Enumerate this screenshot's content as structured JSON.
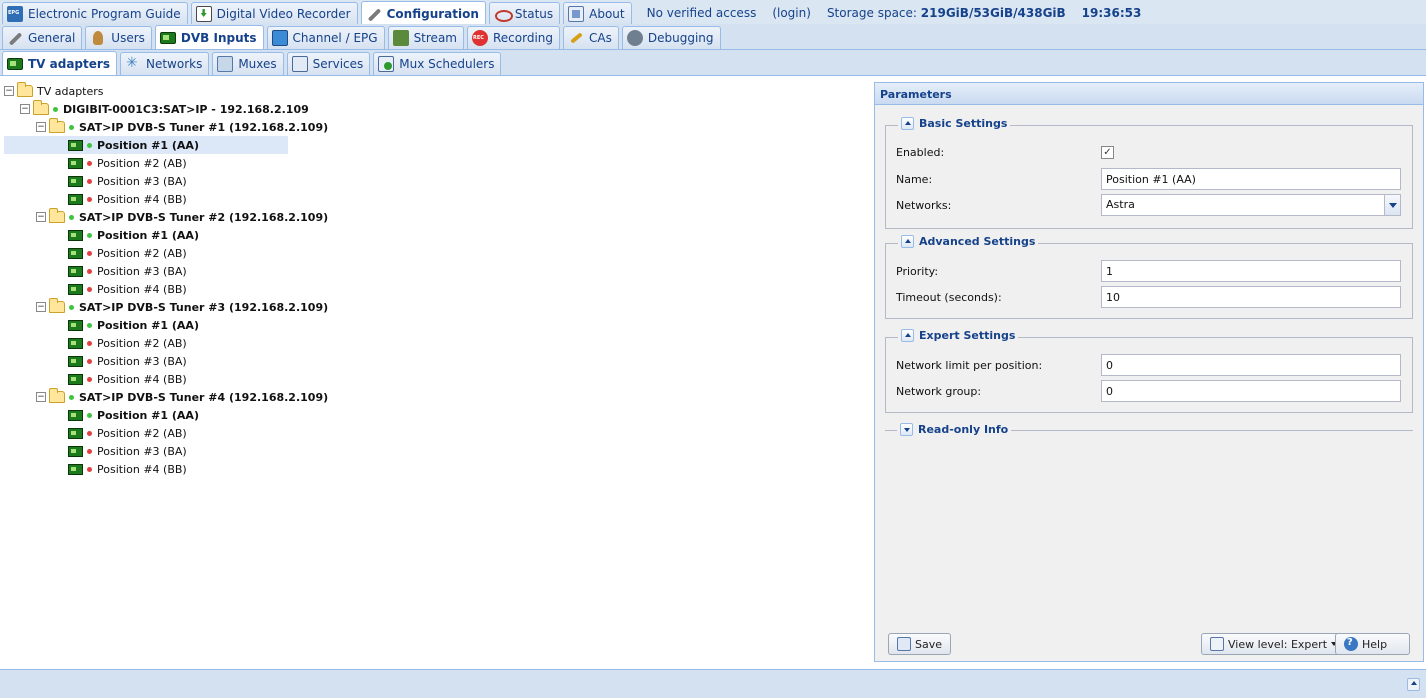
{
  "top_tabs": [
    {
      "label": "Electronic Program Guide",
      "icon": "epg-icon"
    },
    {
      "label": "Digital Video Recorder",
      "icon": "dvr-icon"
    },
    {
      "label": "Configuration",
      "icon": "wrench-icon",
      "active": true
    },
    {
      "label": "Status",
      "icon": "eye-icon"
    },
    {
      "label": "About",
      "icon": "about-icon"
    }
  ],
  "top_info": {
    "access": "No verified access",
    "login": "(login)",
    "storage_label": "Storage space:",
    "storage_value": "219GiB/53GiB/438GiB",
    "time": "19:36:53"
  },
  "config_tabs": [
    {
      "label": "General",
      "icon": "tools-icon"
    },
    {
      "label": "Users",
      "icon": "users-icon"
    },
    {
      "label": "DVB Inputs",
      "icon": "dvb-card-icon",
      "active": true
    },
    {
      "label": "Channel / EPG",
      "icon": "tv-icon"
    },
    {
      "label": "Stream",
      "icon": "stream-icon"
    },
    {
      "label": "Recording",
      "icon": "rec-icon"
    },
    {
      "label": "CAs",
      "icon": "key-icon"
    },
    {
      "label": "Debugging",
      "icon": "debug-icon"
    }
  ],
  "dvb_tabs": [
    {
      "label": "TV adapters",
      "icon": "dvb-card-icon",
      "active": true
    },
    {
      "label": "Networks",
      "icon": "network-icon"
    },
    {
      "label": "Muxes",
      "icon": "mux-icon"
    },
    {
      "label": "Services",
      "icon": "services-icon"
    },
    {
      "label": "Mux Schedulers",
      "icon": "scheduler-icon"
    }
  ],
  "tree": {
    "root": "TV adapters",
    "device": "DIGIBIT-0001C3:SAT>IP - 192.168.2.109",
    "tuners": [
      {
        "label": "SAT>IP DVB-S Tuner #1 (192.168.2.109)",
        "positions": [
          {
            "label": "Position #1 (AA)",
            "status": "green",
            "bold": true,
            "selected": true
          },
          {
            "label": "Position #2 (AB)",
            "status": "red"
          },
          {
            "label": "Position #3 (BA)",
            "status": "red"
          },
          {
            "label": "Position #4 (BB)",
            "status": "red"
          }
        ]
      },
      {
        "label": "SAT>IP DVB-S Tuner #2 (192.168.2.109)",
        "positions": [
          {
            "label": "Position #1 (AA)",
            "status": "green",
            "bold": true
          },
          {
            "label": "Position #2 (AB)",
            "status": "red"
          },
          {
            "label": "Position #3 (BA)",
            "status": "red"
          },
          {
            "label": "Position #4 (BB)",
            "status": "red"
          }
        ]
      },
      {
        "label": "SAT>IP DVB-S Tuner #3 (192.168.2.109)",
        "positions": [
          {
            "label": "Position #1 (AA)",
            "status": "green",
            "bold": true
          },
          {
            "label": "Position #2 (AB)",
            "status": "red"
          },
          {
            "label": "Position #3 (BA)",
            "status": "red"
          },
          {
            "label": "Position #4 (BB)",
            "status": "red"
          }
        ]
      },
      {
        "label": "SAT>IP DVB-S Tuner #4 (192.168.2.109)",
        "positions": [
          {
            "label": "Position #1 (AA)",
            "status": "green",
            "bold": true
          },
          {
            "label": "Position #2 (AB)",
            "status": "red"
          },
          {
            "label": "Position #3 (BA)",
            "status": "red"
          },
          {
            "label": "Position #4 (BB)",
            "status": "red"
          }
        ]
      }
    ]
  },
  "params": {
    "title": "Parameters",
    "basic": {
      "legend": "Basic Settings",
      "enabled_label": "Enabled:",
      "enabled": true,
      "name_label": "Name:",
      "name_value": "Position #1 (AA)",
      "networks_label": "Networks:",
      "networks_value": "Astra"
    },
    "advanced": {
      "legend": "Advanced Settings",
      "priority_label": "Priority:",
      "priority_value": "1",
      "timeout_label": "Timeout (seconds):",
      "timeout_value": "10"
    },
    "expert": {
      "legend": "Expert Settings",
      "netlimit_label": "Network limit per position:",
      "netlimit_value": "0",
      "netgroup_label": "Network group:",
      "netgroup_value": "0"
    },
    "readonly": {
      "legend": "Read-only Info"
    },
    "save_label": "Save",
    "view_level_label": "View level: Expert",
    "help_label": "Help"
  },
  "colors": {
    "accent": "#15428b",
    "status_on": "#3ec43e",
    "status_off": "#e04040",
    "selection": "#dce8f8"
  }
}
